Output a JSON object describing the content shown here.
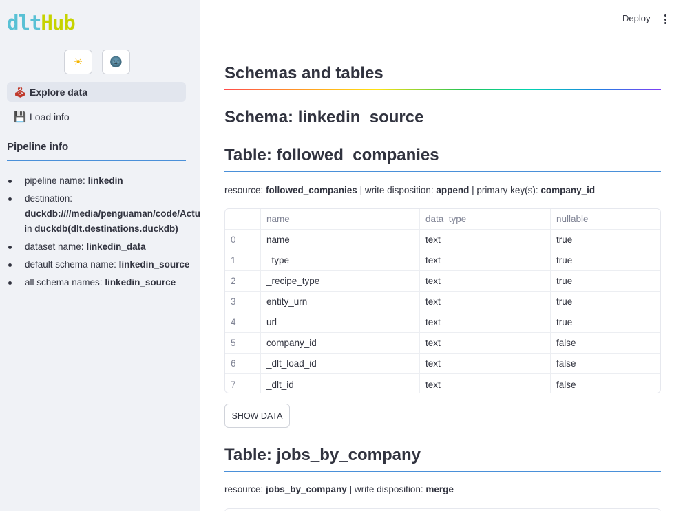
{
  "app": {
    "logo_parts": [
      {
        "text": "dlt",
        "color": "#59c1d5"
      },
      {
        "text": "Hub",
        "color": "#c6d300"
      }
    ]
  },
  "sidebar": {
    "theme_buttons": [
      {
        "icon": "☀",
        "name": "light-mode-icon"
      },
      {
        "icon": "🌚",
        "name": "dark-mode-icon"
      }
    ],
    "nav": [
      {
        "label": "Explore data",
        "icon": "🕹",
        "active": true
      },
      {
        "label": "Load info",
        "icon": "💾",
        "active": false
      }
    ],
    "pipeline_info_title": "Pipeline info",
    "pipeline_info": {
      "pipeline_name_label": "pipeline name: ",
      "pipeline_name": "linkedin",
      "destination_label": "destination:",
      "destination_value": "duckdb:////media/penguaman/code/ActualCode/",
      "destination_in": "in ",
      "destination_module": "duckdb(dlt.destinations.duckdb)",
      "dataset_label": "dataset name: ",
      "dataset_name": "linkedin_data",
      "default_schema_label": "default schema name: ",
      "default_schema": "linkedin_source",
      "all_schema_label": "all schema names: ",
      "all_schema": "linkedin_source"
    }
  },
  "header": {
    "deploy_label": "Deploy"
  },
  "main": {
    "title": "Schemas and tables",
    "schema_heading": "Schema: linkedin_source",
    "table1": {
      "heading": "Table: followed_companies",
      "resource_label": "resource: ",
      "resource": "followed_companies",
      "sep1": " | write disposition: ",
      "write_disposition": "append",
      "sep2": " | primary key(s): ",
      "primary_key": "company_id",
      "columns": [
        "",
        "name",
        "data_type",
        "nullable"
      ],
      "rows": [
        [
          "0",
          "name",
          "text",
          "true"
        ],
        [
          "1",
          "_type",
          "text",
          "true"
        ],
        [
          "2",
          "_recipe_type",
          "text",
          "true"
        ],
        [
          "3",
          "entity_urn",
          "text",
          "true"
        ],
        [
          "4",
          "url",
          "text",
          "true"
        ],
        [
          "5",
          "company_id",
          "text",
          "false"
        ],
        [
          "6",
          "_dlt_load_id",
          "text",
          "false"
        ],
        [
          "7",
          "_dlt_id",
          "text",
          "false"
        ]
      ],
      "show_data_label": "SHOW DATA"
    },
    "table2": {
      "heading": "Table: jobs_by_company",
      "resource_label": "resource: ",
      "resource": "jobs_by_company",
      "sep1": " | write disposition: ",
      "write_disposition": "merge"
    }
  }
}
